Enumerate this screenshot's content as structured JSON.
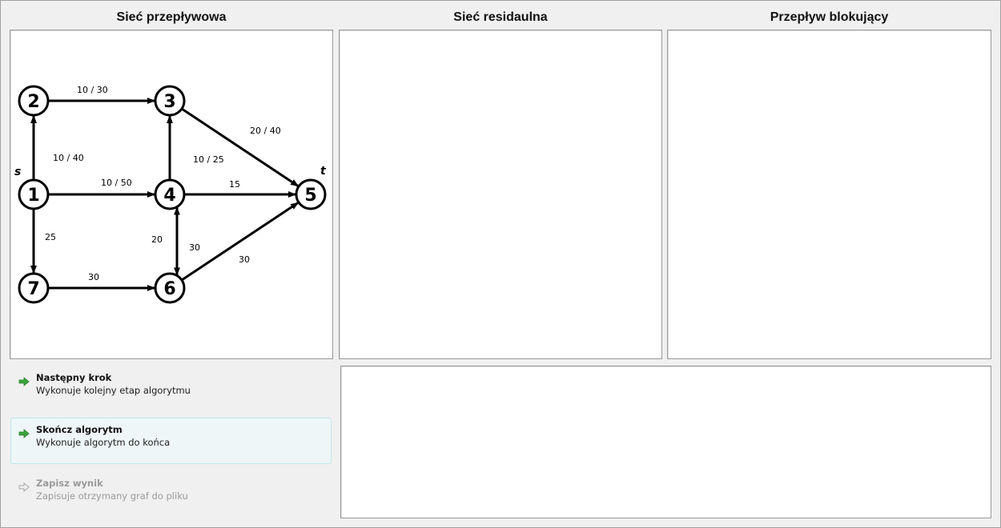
{
  "panels": {
    "flow_network": "Sieć przepływowa",
    "residual_network": "Sieć  residaulna",
    "blocking_flow": "Przepływ blokujący"
  },
  "commands": {
    "next_step": {
      "title": "Następny krok",
      "desc": "Wykonuje kolejny etap algorytmu"
    },
    "finish": {
      "title": "Skończ algorytm",
      "desc": "Wykonuje algorytm do końca"
    },
    "save": {
      "title": "Zapisz wynik",
      "desc": "Zapisuje otrzymany graf do pliku"
    }
  },
  "graph": {
    "source_label": "s",
    "sink_label": "t",
    "nodes": [
      "1",
      "2",
      "3",
      "4",
      "5",
      "6",
      "7"
    ],
    "edges": [
      {
        "from": "1",
        "to": "2",
        "label": "10 / 40"
      },
      {
        "from": "2",
        "to": "3",
        "label": "10 / 30"
      },
      {
        "from": "3",
        "to": "5",
        "label": "20 / 40"
      },
      {
        "from": "4",
        "to": "3",
        "label": "10 / 25"
      },
      {
        "from": "1",
        "to": "4",
        "label": "10 / 50"
      },
      {
        "from": "4",
        "to": "5",
        "label": "15"
      },
      {
        "from": "1",
        "to": "7",
        "label": "25"
      },
      {
        "from": "4",
        "to": "6",
        "label": "20"
      },
      {
        "from": "6",
        "to": "4",
        "label": "30"
      },
      {
        "from": "6",
        "to": "5",
        "label": "30"
      },
      {
        "from": "7",
        "to": "6",
        "label": "30"
      }
    ]
  },
  "icons": {
    "arrow": "green-arrow-icon",
    "arrow_disabled": "gray-arrow-icon"
  },
  "colors": {
    "arrow_green": "#3aa53a",
    "hover_border": "#bfe6ee"
  }
}
